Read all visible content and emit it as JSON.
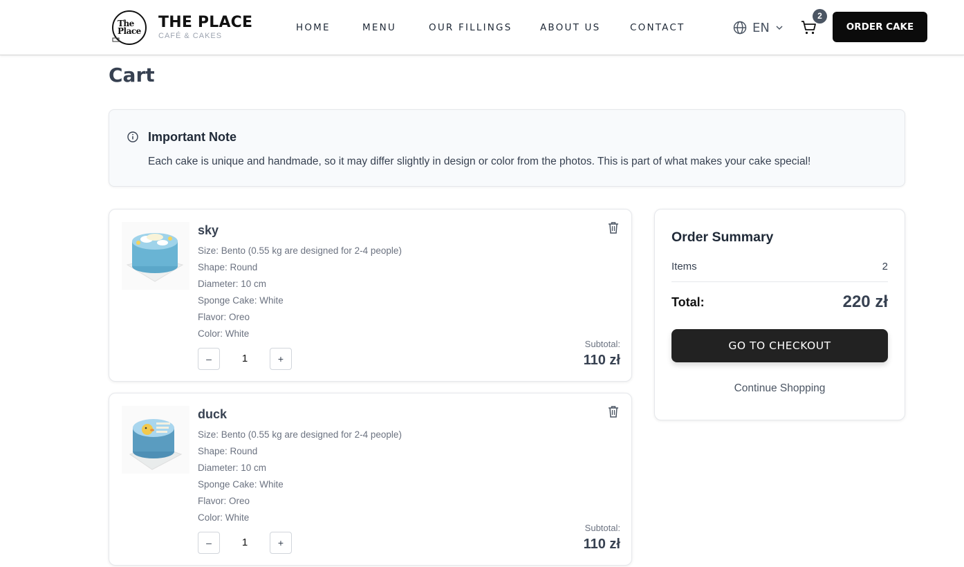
{
  "header": {
    "brand_title": "THE PLACE",
    "brand_subtitle": "CAFÉ & CAKES",
    "logo_text_line1": "The",
    "logo_text_line2": "Place",
    "nav": [
      "HOME",
      "MENU",
      "OUR FILLINGS",
      "ABOUT US",
      "CONTACT"
    ],
    "language": "EN",
    "cart_count": "2",
    "order_button": "ORDER CAKE"
  },
  "page": {
    "title": "Cart"
  },
  "note": {
    "title": "Important Note",
    "text": "Each cake is unique and handmade, so it may differ slightly in design or color from the photos. This is part of what makes your cake special!"
  },
  "cart": {
    "items": [
      {
        "name": "sky",
        "image_icon": "sky-cake-photo",
        "details": [
          "Size: Bento (0.55 kg are designed for 2-4 people)",
          "Shape: Round",
          "Diameter: 10 cm",
          "Sponge Cake: White",
          "Flavor: Oreo",
          "Color:  White"
        ],
        "quantity": "1",
        "minus": "–",
        "plus": "+",
        "subtotal_label": "Subtotal:",
        "subtotal": "110 zł"
      },
      {
        "name": "duck",
        "image_icon": "duck-cake-photo",
        "details": [
          "Size: Bento (0.55 kg are designed for 2-4 people)",
          "Shape: Round",
          "Diameter: 10 cm",
          "Sponge Cake: White",
          "Flavor: Oreo",
          "Color:  White"
        ],
        "quantity": "1",
        "minus": "–",
        "plus": "+",
        "subtotal_label": "Subtotal:",
        "subtotal": "110 zł"
      }
    ]
  },
  "summary": {
    "title": "Order Summary",
    "items_label": "Items",
    "items_value": "2",
    "total_label": "Total:",
    "total_value": "220 zł",
    "checkout_button": "GO TO CHECKOUT",
    "continue_link": "Continue Shopping"
  },
  "colors": {
    "button_dark": "#222222",
    "order_button": "#0b0b0b",
    "note_background": "#f8fafc",
    "text_primary": "#374151",
    "text_muted": "#6b7280"
  }
}
